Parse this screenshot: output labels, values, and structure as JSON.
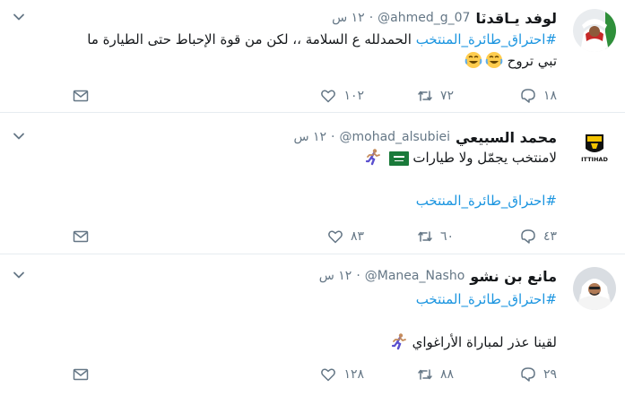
{
  "tweets": [
    {
      "name": "لوفد يـاقدٽا",
      "handle": "@ahmed_g_07",
      "time": "١٢ س",
      "dot": "·",
      "lines": [
        {
          "hashtag": "#احتراق_طائرة_المنتخب",
          "text": " الحمدلله ع السلامة ،، لكن من قوة الإحباط حتى الطيارة ما"
        },
        {
          "text": "تبي تروح ",
          "emoji": "😂😂"
        }
      ],
      "replies": "١٨",
      "retweets": "٧٢",
      "likes": "١٠٢"
    },
    {
      "name": "محمد السبيعي",
      "handle": "@mohad_alsubiei",
      "time": "١٢ س",
      "dot": "·",
      "text_line": "لامنتخب يجمّل ولا طيارات",
      "hashtag_line": "#احتراق_طائرة_المنتخب",
      "replies": "٤٣",
      "retweets": "٦٠",
      "likes": "٨٣"
    },
    {
      "name": "مانع بن نشو",
      "handle": "@Manea_Nasho",
      "time": "١٢ س",
      "dot": "·",
      "hashtag_line": "#احتراق_طائرة_المنتخب",
      "text_line": "لقينا عذر لمباراة الأراغواي",
      "replies": "٢٩",
      "retweets": "٨٨",
      "likes": "١٢٨"
    }
  ],
  "icons": {
    "reply": "reply-icon",
    "retweet": "retweet-icon",
    "like": "heart-icon",
    "dm": "envelope-icon",
    "menu": "chevron-down-icon"
  },
  "colors": {
    "hashtag": "#1b95e0",
    "secondary_text": "#657786",
    "flag_green": "#1a7a3a"
  }
}
